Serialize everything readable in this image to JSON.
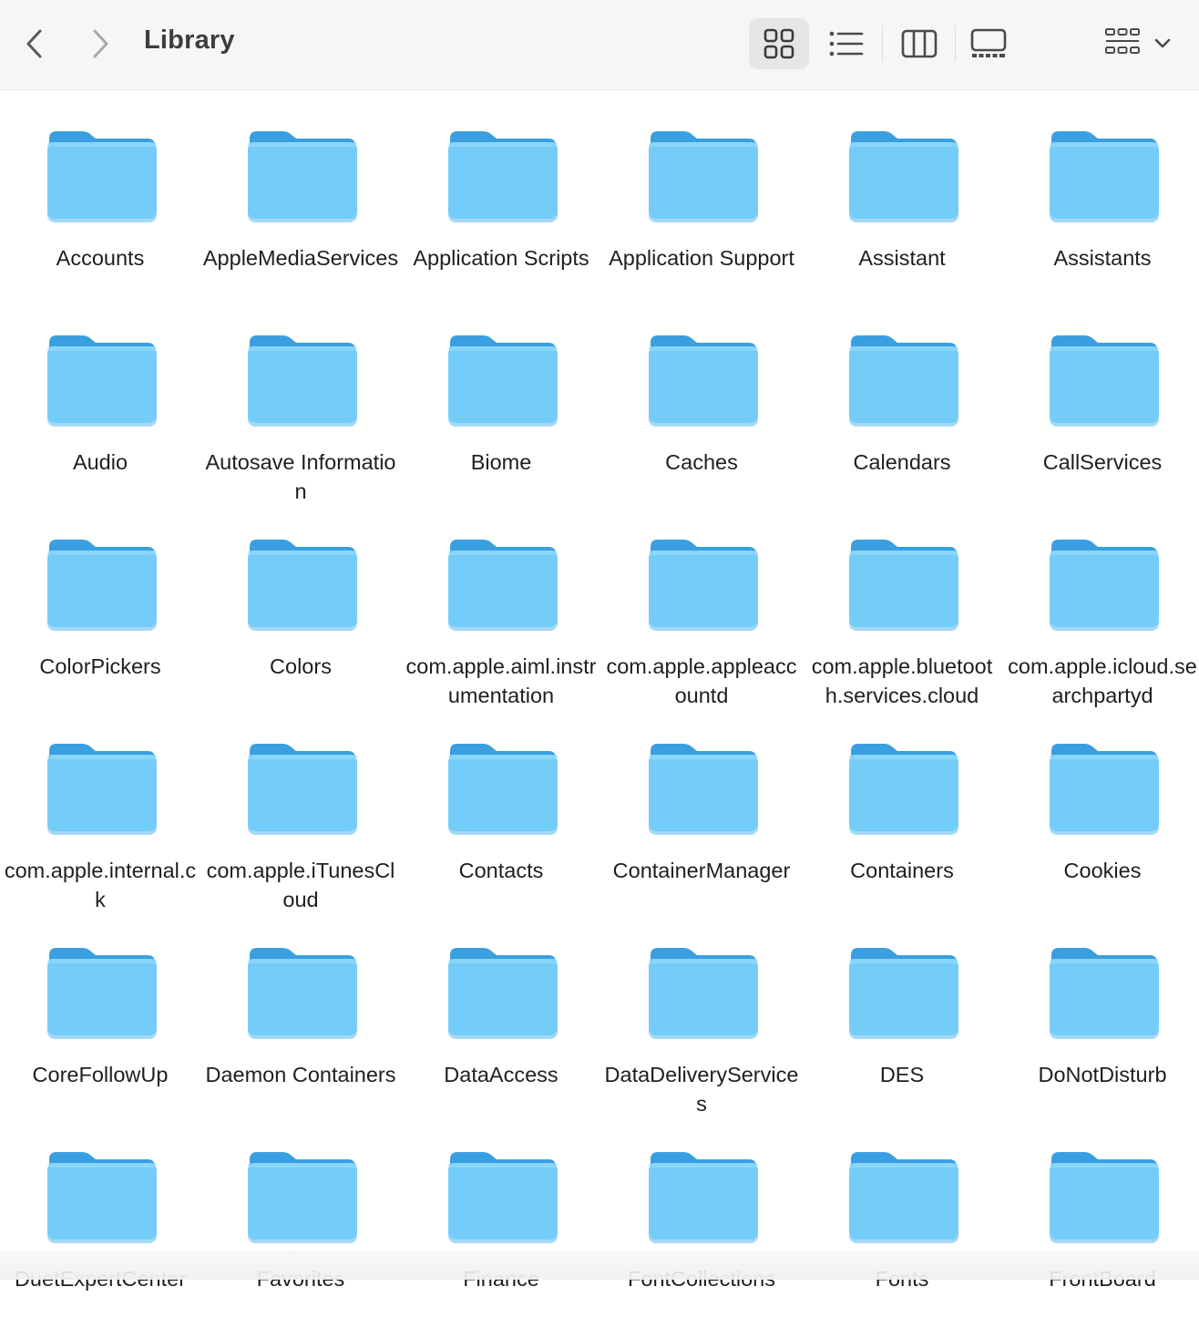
{
  "toolbar": {
    "title": "Library",
    "back_icon": "chevron-left-icon",
    "forward_icon": "chevron-right-icon",
    "views": [
      {
        "name": "icon-view",
        "icon": "grid-icon",
        "active": true
      },
      {
        "name": "list-view",
        "icon": "list-icon",
        "active": false
      },
      {
        "name": "column-view",
        "icon": "columns-icon",
        "active": false
      },
      {
        "name": "gallery-view",
        "icon": "gallery-icon",
        "active": false
      }
    ],
    "group_icon": "group-by-icon",
    "group_chevron": "chevron-down-icon"
  },
  "colors": {
    "folder_front": "#74cdf8",
    "folder_back": "#3a9fe0",
    "folder_edge": "#5bb8f0",
    "toolbar_bg": "#f6f6f6",
    "active_view_bg": "#e6e6e6"
  },
  "folders": [
    {
      "name": "Accounts"
    },
    {
      "name": "AppleMediaServices"
    },
    {
      "name": "Application Scripts"
    },
    {
      "name": "Application Support"
    },
    {
      "name": "Assistant"
    },
    {
      "name": "Assistants"
    },
    {
      "name": "Audio"
    },
    {
      "name": "Autosave Information"
    },
    {
      "name": "Biome"
    },
    {
      "name": "Caches"
    },
    {
      "name": "Calendars"
    },
    {
      "name": "CallServices"
    },
    {
      "name": "ColorPickers"
    },
    {
      "name": "Colors"
    },
    {
      "name": "com.apple.aiml.instrumentation"
    },
    {
      "name": "com.apple.appleaccountd"
    },
    {
      "name": "com.apple.bluetooth.services.cloud"
    },
    {
      "name": "com.apple.icloud.searchpartyd"
    },
    {
      "name": "com.apple.internal.ck"
    },
    {
      "name": "com.apple.iTunesCloud"
    },
    {
      "name": "Contacts"
    },
    {
      "name": "ContainerManager"
    },
    {
      "name": "Containers"
    },
    {
      "name": "Cookies"
    },
    {
      "name": "CoreFollowUp"
    },
    {
      "name": "Daemon Containers"
    },
    {
      "name": "DataAccess"
    },
    {
      "name": "DataDeliveryServices"
    },
    {
      "name": "DES"
    },
    {
      "name": "DoNotDisturb"
    },
    {
      "name": "DuetExpertCenter"
    },
    {
      "name": "Favorites"
    },
    {
      "name": "Finance"
    },
    {
      "name": "FontCollections"
    },
    {
      "name": "Fonts"
    },
    {
      "name": "FrontBoard"
    }
  ]
}
